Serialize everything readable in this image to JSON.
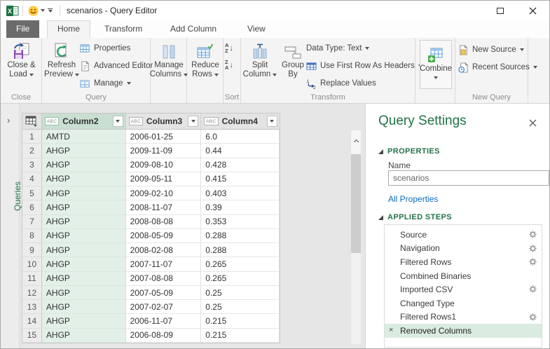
{
  "window": {
    "title": "scenarios - Query Editor"
  },
  "tabs": {
    "file": "File",
    "items": [
      "Home",
      "Transform",
      "Add Column",
      "View"
    ],
    "active_tab": "Home"
  },
  "ribbon": {
    "close_load": {
      "line1": "Close &",
      "line2": "Load"
    },
    "close_group_label": "Close",
    "refresh_preview": {
      "line1": "Refresh",
      "line2": "Preview"
    },
    "properties": "Properties",
    "advanced_editor": "Advanced Editor",
    "manage": "Manage",
    "query_group_label": "Query",
    "manage_columns": {
      "line1": "Manage",
      "line2": "Columns"
    },
    "reduce_rows": {
      "line1": "Reduce",
      "line2": "Rows"
    },
    "sort_group_label": "Sort",
    "split_column": {
      "line1": "Split",
      "line2": "Column"
    },
    "group_by": {
      "line1": "Group",
      "line2": "By"
    },
    "data_type": "Data Type: Text",
    "use_first_row": "Use First Row As Headers",
    "replace_values": "Replace Values",
    "transform_group_label": "Transform",
    "combine": "Combine",
    "new_source": "New Source",
    "recent_sources": "Recent Sources",
    "new_query_group_label": "New Query"
  },
  "queries_pane": {
    "label": "Queries"
  },
  "grid": {
    "columns": [
      {
        "badge": "ABC",
        "name": "Column2",
        "selected": true
      },
      {
        "badge": "ABC",
        "name": "Column3",
        "selected": false
      },
      {
        "badge": "ABC",
        "name": "Column4",
        "selected": false
      }
    ],
    "rows": [
      [
        "1",
        "AMTD",
        "2006-01-25",
        "6.0"
      ],
      [
        "2",
        "AHGP",
        "2009-11-09",
        "0.44"
      ],
      [
        "3",
        "AHGP",
        "2009-08-10",
        "0.428"
      ],
      [
        "4",
        "AHGP",
        "2009-05-11",
        "0.415"
      ],
      [
        "5",
        "AHGP",
        "2009-02-10",
        "0.403"
      ],
      [
        "6",
        "AHGP",
        "2008-11-07",
        "0.39"
      ],
      [
        "7",
        "AHGP",
        "2008-08-08",
        "0.353"
      ],
      [
        "8",
        "AHGP",
        "2008-05-09",
        "0.288"
      ],
      [
        "9",
        "AHGP",
        "2008-02-08",
        "0.288"
      ],
      [
        "10",
        "AHGP",
        "2007-11-07",
        "0.265"
      ],
      [
        "11",
        "AHGP",
        "2007-08-08",
        "0.265"
      ],
      [
        "12",
        "AHGP",
        "2007-05-09",
        "0.25"
      ],
      [
        "13",
        "AHGP",
        "2007-02-07",
        "0.25"
      ],
      [
        "14",
        "AHGP",
        "2006-11-07",
        "0.215"
      ],
      [
        "15",
        "AHGP",
        "2006-08-09",
        "0.215"
      ]
    ]
  },
  "query_settings": {
    "title": "Query Settings",
    "properties_header": "PROPERTIES",
    "name_label": "Name",
    "name_value": "scenarios",
    "all_properties_link": "All Properties",
    "applied_steps_header": "APPLIED STEPS",
    "steps": [
      {
        "label": "Source",
        "gear": true,
        "selected": false
      },
      {
        "label": "Navigation",
        "gear": true,
        "selected": false
      },
      {
        "label": "Filtered Rows",
        "gear": true,
        "selected": false
      },
      {
        "label": "Combined Binaries",
        "gear": false,
        "selected": false
      },
      {
        "label": "Imported CSV",
        "gear": true,
        "selected": false
      },
      {
        "label": "Changed Type",
        "gear": false,
        "selected": false
      },
      {
        "label": "Filtered Rows1",
        "gear": true,
        "selected": false
      },
      {
        "label": "Removed Columns",
        "gear": false,
        "selected": true
      }
    ]
  },
  "colors": {
    "accent-green": "#217346",
    "link-blue": "#0B6CBD",
    "file-tab-bg": "#6B6B6B",
    "selected-column-bg": "#E3F0E8",
    "selected-header-bg": "#C8DFD2",
    "step-selected-bg": "#DAEBE0",
    "smiley-yellow": "#FFC83D"
  }
}
